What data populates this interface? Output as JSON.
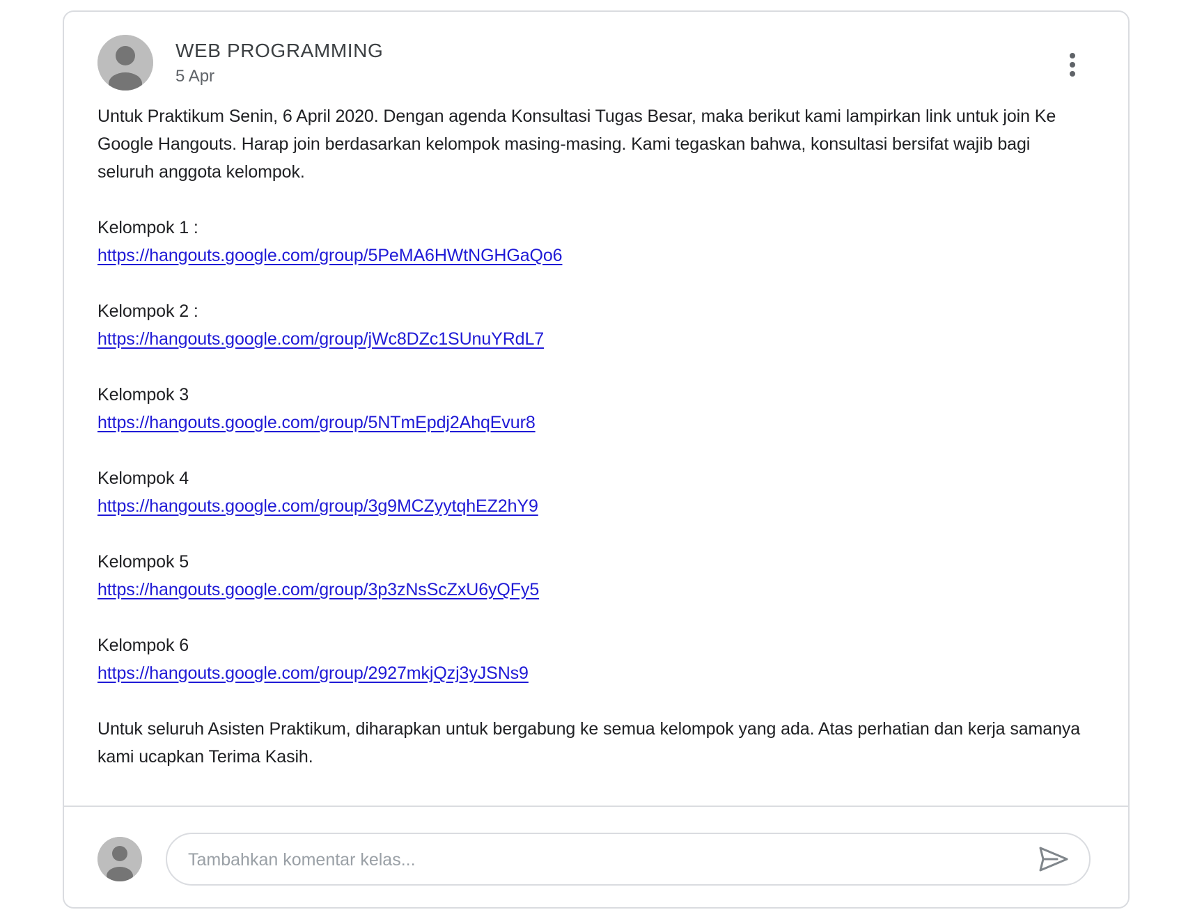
{
  "post": {
    "author": "WEB PROGRAMMING",
    "date": "5 Apr",
    "more_options_icon": "more-vert-icon",
    "intro": "Untuk Praktikum Senin, 6 April 2020. Dengan agenda Konsultasi Tugas Besar, maka berikut kami lampirkan link untuk join Ke Google Hangouts. Harap join berdasarkan kelompok masing-masing. Kami tegaskan bahwa, konsultasi bersifat wajib bagi seluruh anggota kelompok.",
    "groups": [
      {
        "label": "Kelompok 1 :",
        "link": "https://hangouts.google.com/group/5PeMA6HWtNGHGaQo6"
      },
      {
        "label": "Kelompok 2 :",
        "link": "https://hangouts.google.com/group/jWc8DZc1SUnuYRdL7"
      },
      {
        "label": "Kelompok 3",
        "link": "https://hangouts.google.com/group/5NTmEpdj2AhqEvur8"
      },
      {
        "label": "Kelompok 4",
        "link": "https://hangouts.google.com/group/3g9MCZyytqhEZ2hY9"
      },
      {
        "label": "Kelompok 5",
        "link": "https://hangouts.google.com/group/3p3zNsScZxU6yQFy5"
      },
      {
        "label": "Kelompok 6",
        "link": "https://hangouts.google.com/group/2927mkjQzj3yJSNs9"
      }
    ],
    "closing": "Untuk seluruh Asisten Praktikum, diharapkan untuk bergabung ke semua kelompok yang ada. Atas perhatian dan kerja samanya kami ucapkan Terima Kasih."
  },
  "comment": {
    "placeholder": "Tambahkan komentar kelas...",
    "send_icon": "send-icon"
  },
  "colors": {
    "link": "#1f1ad6",
    "border": "#dadce0",
    "avatar_bg": "#bdbdbd",
    "avatar_fg": "#757575"
  }
}
